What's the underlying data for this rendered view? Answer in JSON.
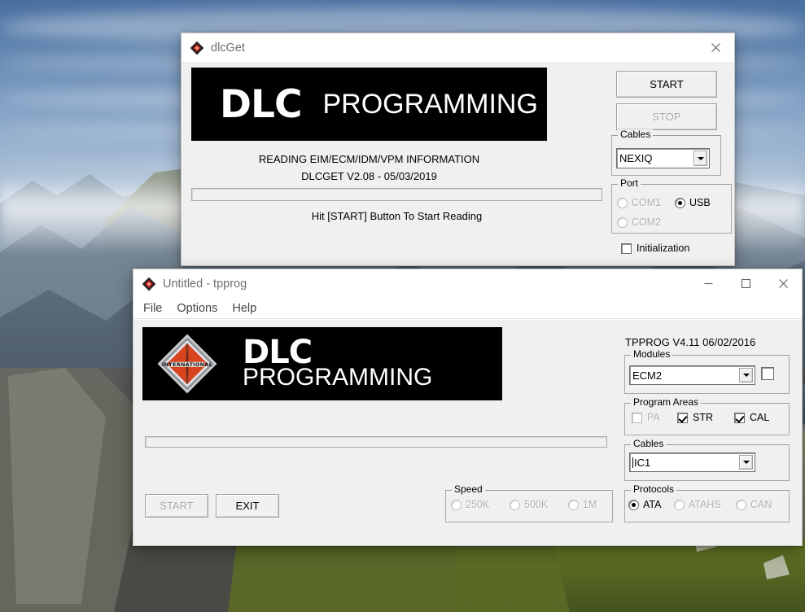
{
  "desktop": {
    "wallpaper_description": "mountain-landscape-wallpaper",
    "sky_color": "#8fb0ce",
    "rock_color": "#6d7a88",
    "moss_color": "#7f9b2a"
  },
  "dlcget_window": {
    "title": "dlcGet",
    "icon": "diamond-app-icon",
    "close_label": "close-icon",
    "banner": {
      "dlc_text": "DLC",
      "programming_text": "PROGRAMMING"
    },
    "info_line1": "READING EIM/ECM/IDM/VPM INFORMATION",
    "info_line2": "DLCGET V2.08 - 05/03/2019",
    "hint_text": "Hit [START] Button To Start Reading",
    "progress_value": 0,
    "start_button": "START",
    "stop_button": "STOP",
    "cables_group": {
      "title": "Cables",
      "selected": "NEXIQ",
      "options": [
        "NEXIQ"
      ]
    },
    "port_group": {
      "title": "Port",
      "options": [
        {
          "label": "COM1",
          "selected": false,
          "enabled": false
        },
        {
          "label": "USB",
          "selected": true,
          "enabled": true
        },
        {
          "label": "COM2",
          "selected": false,
          "enabled": false
        }
      ]
    },
    "initialization_checkbox": {
      "label": "Initialization",
      "checked": false
    }
  },
  "tpprog_window": {
    "title": "Untitled - tpprog",
    "icon": "diamond-app-icon",
    "menu": [
      "File",
      "Options",
      "Help"
    ],
    "window_buttons": [
      "minimize-icon",
      "maximize-icon",
      "close-icon"
    ],
    "banner": {
      "logo": "international-diamond-logo",
      "logo_text": "INTERNATIONAL",
      "dlc_text": "DLC",
      "programming_text": "PROGRAMMING"
    },
    "version_text": "TPPROG V4.11   06/02/2016",
    "progress_value": 0,
    "start_button": "START",
    "exit_button": "EXIT",
    "modules_group": {
      "title": "Modules",
      "selected": "ECM2",
      "options": [
        "ECM2"
      ],
      "side_checkbox_checked": false
    },
    "program_areas_group": {
      "title": "Program Areas",
      "items": [
        {
          "label": "PA",
          "checked": false,
          "enabled": false
        },
        {
          "label": "STR",
          "checked": true,
          "enabled": true
        },
        {
          "label": "CAL",
          "checked": true,
          "enabled": true
        }
      ]
    },
    "cables_group": {
      "title": "Cables",
      "selected": "IC1",
      "options": [
        "IC1"
      ]
    },
    "protocols_group": {
      "title": "Protocols",
      "items": [
        {
          "label": "ATA",
          "selected": true,
          "enabled": true
        },
        {
          "label": "ATAHS",
          "selected": false,
          "enabled": false
        },
        {
          "label": "CAN",
          "selected": false,
          "enabled": false
        }
      ]
    },
    "speed_group": {
      "title": "Speed",
      "items": [
        {
          "label": "250K",
          "selected": false,
          "enabled": false
        },
        {
          "label": "500K",
          "selected": false,
          "enabled": false
        },
        {
          "label": "1M",
          "selected": false,
          "enabled": false
        }
      ]
    }
  }
}
